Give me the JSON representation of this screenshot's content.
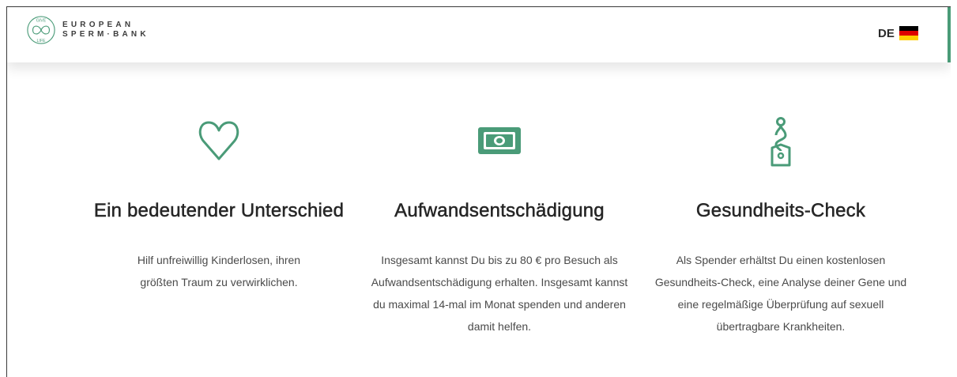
{
  "brand": {
    "line1": "EUROPEAN",
    "line2": "SPERM·BANK",
    "mark_word_top": "GIVE",
    "mark_word_bottom": "LIFE",
    "color": "#4a9b78"
  },
  "header": {
    "lang_code": "DE",
    "flag_colors": [
      "#000000",
      "#dd0000",
      "#ffce00"
    ],
    "accent_color": "#4a9b78"
  },
  "features": [
    {
      "icon": "heart-icon",
      "title": "Ein bedeutender Unterschied",
      "text": "Hilf unfreiwillig Kinderlosen, ihren größten Traum zu verwirklichen."
    },
    {
      "icon": "banknote-icon",
      "title": "Aufwandsentschädigung",
      "text": "Insgesamt kannst Du bis zu 80 € pro Besuch als Aufwandsentschädigung erhalten. Insgesamt kannst du maximal 14-mal im Monat spenden und anderen damit helfen."
    },
    {
      "icon": "stethoscope-icon",
      "title": "Gesundheits-Check",
      "text": "Als Spender erhältst Du einen kostenlosen Gesundheits-Check, eine Analyse deiner Gene und eine regelmäßige Überprüfung auf sexuell übertragbare Krankheiten."
    }
  ]
}
